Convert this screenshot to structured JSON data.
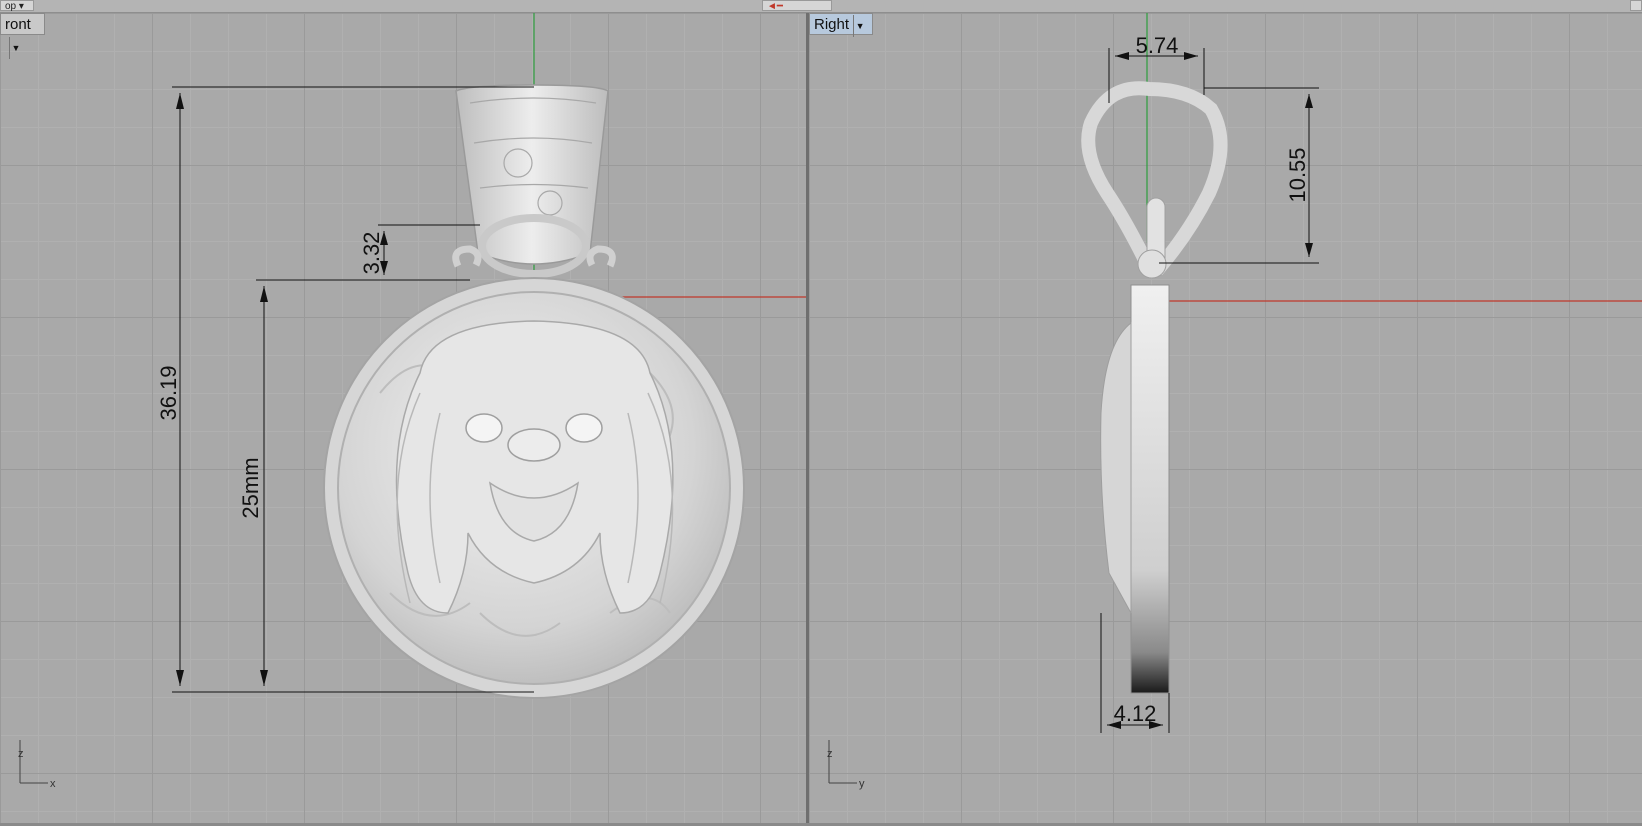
{
  "topbar": {
    "left_tab": "op",
    "right_tab": ""
  },
  "front_view": {
    "label": "ront",
    "dimensions": {
      "total_height": "36.19",
      "medallion_height": "25mm",
      "bail_gap": "3.32"
    },
    "axes": {
      "vertical": "z",
      "horizontal": "x"
    }
  },
  "right_view": {
    "label": "Right",
    "dimensions": {
      "bail_width": "5.74",
      "bail_height": "10.55",
      "thickness": "4.12"
    },
    "axes": {
      "vertical": "z",
      "horizontal": "y"
    }
  },
  "colors": {
    "x_axis": "#c0392b",
    "y_axis": "#2e9e3e",
    "dimension_line": "#111111",
    "model": "#dcdcdc"
  }
}
